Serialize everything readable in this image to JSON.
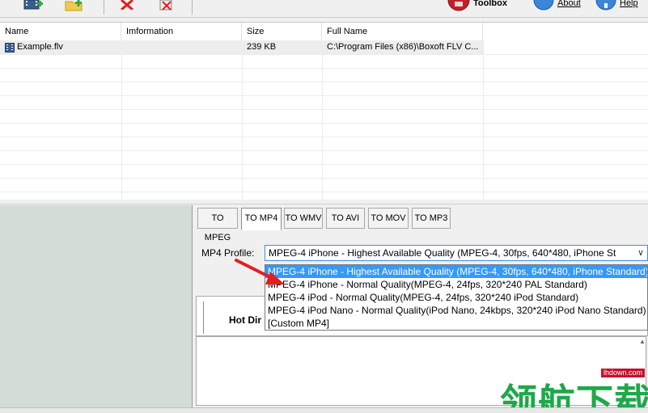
{
  "toolbar": {
    "toolbox_label": "Toolbox",
    "about_label": "About",
    "help_label": "Help"
  },
  "filelist": {
    "columns": [
      "Name",
      "Imformation",
      "Size",
      "Full Name"
    ],
    "rows": [
      {
        "name": "Example.flv",
        "information": "",
        "size": "239 KB",
        "full_name": "C:\\Program Files (x86)\\Boxoft FLV C..."
      }
    ]
  },
  "tabs": [
    "TO MPEG",
    "TO MP4",
    "TO WMV",
    "TO AVI",
    "TO MOV",
    "TO MP3"
  ],
  "active_tab": "TO MP4",
  "profile": {
    "label": "MP4 Profile:",
    "selected": "MPEG-4 iPhone - Highest Available Quality (MPEG-4, 30fps, 640*480, iPhone St",
    "options": [
      "MPEG-4 iPhone - Highest Available Quality (MPEG-4, 30fps, 640*480, iPhone Standard)",
      "MPEG-4 iPhone - Normal Quality(MPEG-4, 24fps, 320*240 PAL Standard)",
      "MPEG-4 iPod - Normal Quality(MPEG-4, 24fps, 320*240 iPod Standard)",
      "MPEG-4 iPod Nano - Normal Quality(iPod Nano, 24kbps, 320*240  iPod Nano Standard)",
      "[Custom MP4]"
    ]
  },
  "hot_dir_label": "Hot Dir",
  "watermark": {
    "url": "lhdown.com",
    "text": "领航下载"
  },
  "colors": {
    "selection": "#3399ff",
    "arrow": "#e02020",
    "watermark": "#1fa84a"
  }
}
